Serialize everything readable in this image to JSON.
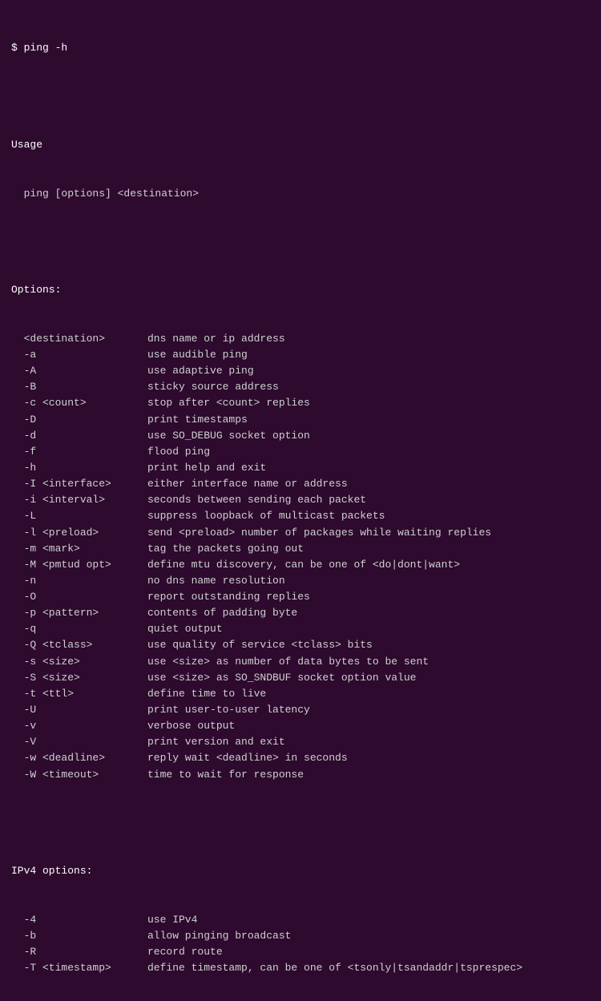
{
  "terminal": {
    "command": "$ ping -h",
    "blank1": "",
    "usage_label": "Usage",
    "usage_cmd": "  ping [options] <destination>",
    "blank2": "",
    "options_label": "Options:",
    "options": [
      {
        "key": "  <destination>",
        "desc": "dns name or ip address"
      },
      {
        "key": "  -a",
        "desc": "use audible ping"
      },
      {
        "key": "  -A",
        "desc": "use adaptive ping"
      },
      {
        "key": "  -B",
        "desc": "sticky source address"
      },
      {
        "key": "  -c <count>",
        "desc": "stop after <count> replies"
      },
      {
        "key": "  -D",
        "desc": "print timestamps"
      },
      {
        "key": "  -d",
        "desc": "use SO_DEBUG socket option"
      },
      {
        "key": "  -f",
        "desc": "flood ping"
      },
      {
        "key": "  -h",
        "desc": "print help and exit"
      },
      {
        "key": "  -I <interface>",
        "desc": "either interface name or address"
      },
      {
        "key": "  -i <interval>",
        "desc": "seconds between sending each packet"
      },
      {
        "key": "  -L",
        "desc": "suppress loopback of multicast packets"
      },
      {
        "key": "  -l <preload>",
        "desc": "send <preload> number of packages while waiting replies"
      },
      {
        "key": "  -m <mark>",
        "desc": "tag the packets going out"
      },
      {
        "key": "  -M <pmtud opt>",
        "desc": "define mtu discovery, can be one of <do|dont|want>"
      },
      {
        "key": "  -n",
        "desc": "no dns name resolution"
      },
      {
        "key": "  -O",
        "desc": "report outstanding replies"
      },
      {
        "key": "  -p <pattern>",
        "desc": "contents of padding byte"
      },
      {
        "key": "  -q",
        "desc": "quiet output"
      },
      {
        "key": "  -Q <tclass>",
        "desc": "use quality of service <tclass> bits"
      },
      {
        "key": "  -s <size>",
        "desc": "use <size> as number of data bytes to be sent"
      },
      {
        "key": "  -S <size>",
        "desc": "use <size> as SO_SNDBUF socket option value"
      },
      {
        "key": "  -t <ttl>",
        "desc": "define time to live"
      },
      {
        "key": "  -U",
        "desc": "print user-to-user latency"
      },
      {
        "key": "  -v",
        "desc": "verbose output"
      },
      {
        "key": "  -V",
        "desc": "print version and exit"
      },
      {
        "key": "  -w <deadline>",
        "desc": "reply wait <deadline> in seconds"
      },
      {
        "key": "  -W <timeout>",
        "desc": "time to wait for response"
      }
    ],
    "blank3": "",
    "ipv4_label": "IPv4 options:",
    "ipv4_options": [
      {
        "key": "  -4",
        "desc": "use IPv4"
      },
      {
        "key": "  -b",
        "desc": "allow pinging broadcast"
      },
      {
        "key": "  -R",
        "desc": "record route"
      },
      {
        "key": "  -T <timestamp>",
        "desc": "define timestamp, can be one of <tsonly|tsandaddr|tsprespec>"
      }
    ]
  }
}
